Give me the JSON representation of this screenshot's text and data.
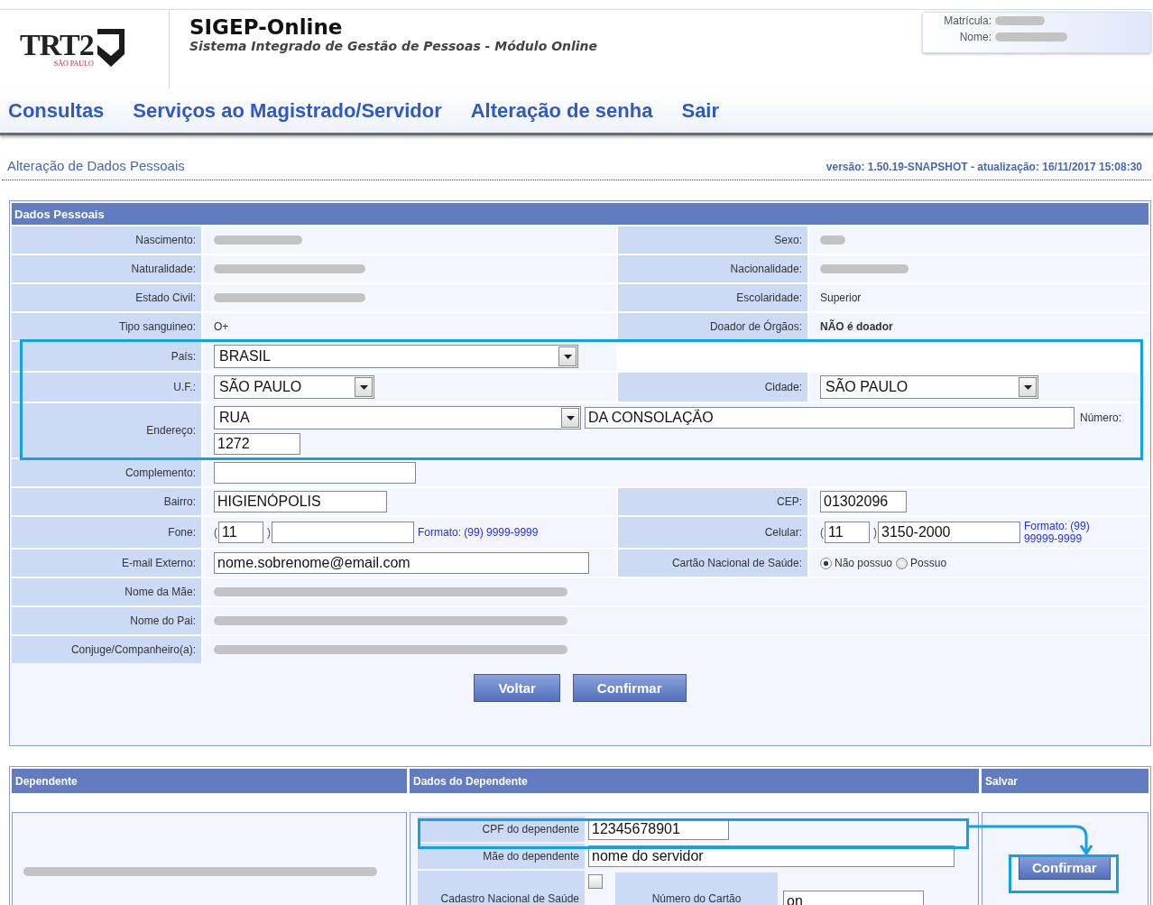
{
  "header": {
    "logo": {
      "text": "TRT2",
      "subtext": "SÃO PAULO"
    },
    "title": "SIGEP-Online",
    "subtitle": "Sistema Integrado de Gestão de Pessoas - Módulo Online",
    "user": [
      {
        "label": "Matrícula:"
      },
      {
        "label": "Nome:"
      }
    ]
  },
  "nav": [
    "Consultas",
    "Serviços ao Magistrado/Servidor",
    "Alteração de senha",
    "Sair"
  ],
  "page_title": "Alteração de Dados Pessoais",
  "version": "versão: 1.50.19-SNAPSHOT - atualização: 16/11/2017 15:08:30",
  "personal": {
    "title": "Dados Pessoais",
    "rows": [
      {
        "cells": [
          {
            "label": "Nascimento:",
            "kind": "redacted"
          },
          {
            "label": "Sexo:",
            "kind": "redacted"
          }
        ]
      },
      {
        "cells": [
          {
            "label": "Naturalidade:",
            "kind": "redacted"
          },
          {
            "label": "Nacionalidade:",
            "kind": "redacted"
          }
        ]
      },
      {
        "cells": [
          {
            "label": "Estado Civil:",
            "kind": "redacted"
          },
          {
            "label": "Escolaridade:",
            "kind": "text",
            "value": "Superior"
          }
        ]
      },
      {
        "cells": [
          {
            "label": "Tipo sanguineo:",
            "kind": "text",
            "value": "O+"
          },
          {
            "label": "Doador de Órgãos:",
            "kind": "bold",
            "value": "NÃO é doador"
          }
        ]
      },
      {
        "cells": [
          {
            "label": "País:",
            "kind": "select",
            "value": "BRASIL"
          }
        ]
      },
      {
        "cells": [
          {
            "label": "U.F.:",
            "kind": "select",
            "value": "SÃO PAULO"
          },
          {
            "label": "Cidade:",
            "kind": "select",
            "value": "SÃO PAULO"
          }
        ]
      },
      {
        "cells": [
          {
            "label": "Endereço:",
            "kind": "address",
            "type": "RUA",
            "street": "DA CONSOLAÇÃO",
            "number_label": "Número:",
            "number": "1272"
          }
        ]
      },
      {
        "cells": [
          {
            "label": "Complemento:",
            "kind": "input"
          }
        ]
      },
      {
        "cells": [
          {
            "label": "Bairro:",
            "kind": "input",
            "value": "HIGIENÓPOLIS"
          },
          {
            "label": "CEP:",
            "kind": "input",
            "value": "01302096"
          }
        ]
      },
      {
        "cells": [
          {
            "label": "Fone:",
            "kind": "phone",
            "open": "(",
            "area": "11",
            "close": ")",
            "hint": "Formato: (99) 9999-9999"
          },
          {
            "label": "Celular:",
            "kind": "phone",
            "open": "(",
            "area": "11",
            "close": ")",
            "number": "3150-2000",
            "hint": "Formato: (99) 99999-9999"
          }
        ]
      },
      {
        "cells": [
          {
            "label": "E-mail Externo:",
            "kind": "input",
            "value": "nome.sobrenome@email.com"
          },
          {
            "label": "Cartão Nacional de Saúde:",
            "kind": "radio",
            "options": [
              {
                "label": "Não possuo",
                "selected": true
              },
              {
                "label": "Possuo",
                "selected": false
              }
            ]
          }
        ]
      },
      {
        "cells": [
          {
            "label": "Nome da Mãe:",
            "kind": "redacted"
          }
        ]
      },
      {
        "cells": [
          {
            "label": "Nome do Pai:",
            "kind": "redacted"
          }
        ]
      },
      {
        "cells": [
          {
            "label": "Conjuge/Companheiro(a):",
            "kind": "redacted"
          }
        ]
      }
    ],
    "buttons": [
      "Voltar",
      "Confirmar"
    ]
  },
  "dependents": {
    "columns": [
      "Dependente",
      "Dados do Dependente",
      "Salvar"
    ],
    "rows": [
      {
        "label": "CPF do dependente",
        "kind": "input",
        "value": "12345678901"
      },
      {
        "label": "Mãe do dependente",
        "kind": "input",
        "value": "nome do servidor"
      },
      {
        "label": "Cadastro Nacional de Saúde",
        "kind": "checkbox",
        "checked": false,
        "card_label": "Número do Cartão",
        "card_value": "on"
      }
    ],
    "save_button": "Confirmar"
  }
}
